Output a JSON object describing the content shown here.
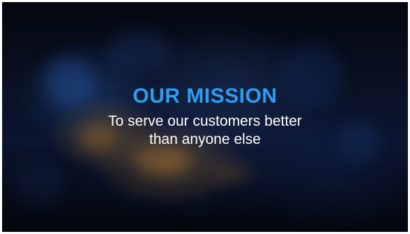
{
  "slide": {
    "title": "OUR MISSION",
    "subtitle_line1": "To serve our customers better",
    "subtitle_line2": "than anyone else",
    "colors": {
      "title": "#2e9cf0",
      "subtitle": "#ffffff",
      "background": "#0a1226"
    }
  }
}
